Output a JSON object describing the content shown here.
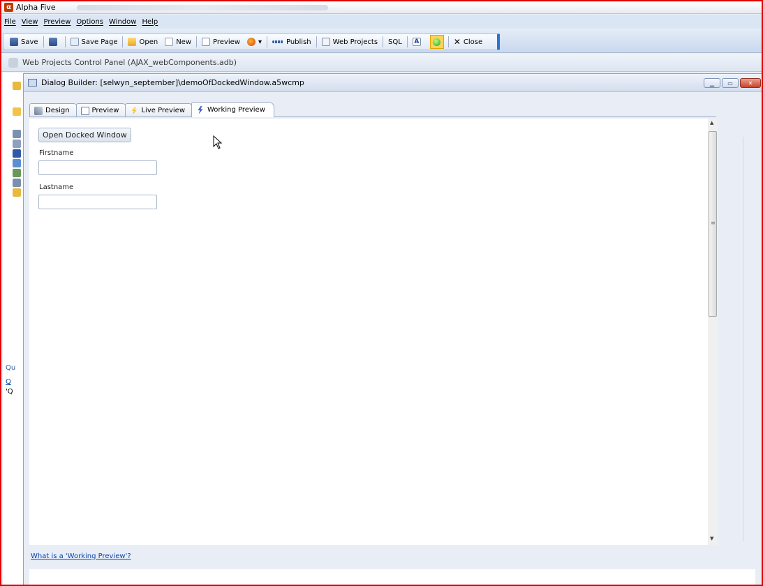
{
  "app": {
    "title": "Alpha Five"
  },
  "menu": [
    "File",
    "View",
    "Preview",
    "Options",
    "Window",
    "Help"
  ],
  "toolbar": {
    "save": "Save",
    "save_page": "Save Page",
    "open": "Open",
    "new": "New",
    "preview": "Preview",
    "publish": "Publish",
    "web_projects": "Web Projects",
    "sql": "SQL",
    "close": "Close"
  },
  "control_panel": {
    "title": "Web Projects Control Panel (AJAX_webComponents.adb)"
  },
  "back_panel": {
    "text_q1": "Qu",
    "text_q2": "Q",
    "text_q3": "'Q"
  },
  "dialog": {
    "title": "Dialog Builder: [selwyn_september]\\demoOfDockedWindow.a5wcmp",
    "tabs": [
      "Design",
      "Preview",
      "Live Preview",
      "Working Preview"
    ]
  },
  "form": {
    "open_button": "Open Docked Window",
    "firstname_label": "Firstname",
    "lastname_label": "Lastname",
    "firstname_value": "",
    "lastname_value": ""
  },
  "help_link": "What is a 'Working Preview'?"
}
